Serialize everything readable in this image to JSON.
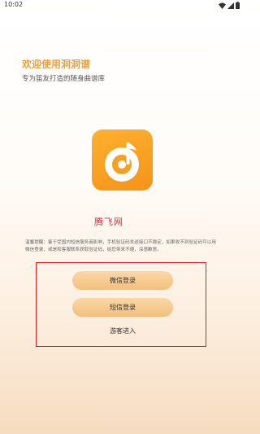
{
  "status_bar": {
    "time": "10:02",
    "icons": [
      "wifi-icon",
      "signal-icon",
      "battery-icon"
    ]
  },
  "welcome": {
    "title": "欢迎使用洞洞谱",
    "subtitle": "专为笛友打造的随身曲谱库"
  },
  "logo": {
    "icon": "music-note-logo-icon",
    "colors": {
      "primary": "#f5a623",
      "foreground": "#ffffff"
    }
  },
  "brand": {
    "name": "腾飞网"
  },
  "notice": {
    "text": "温馨提醒：鉴于受国内短信服务商影响，手机验证码发送接口不稳定，如果收不到验证码可以用微信登录，或是和客服联系获取验证码，给您带来不便，深感歉意。"
  },
  "actions": {
    "wechat_login": "微信登录",
    "sms_login": "短信登录",
    "guest_entry": "游客进入"
  },
  "colors": {
    "accent": "#f0a030",
    "button": "#f5c88a",
    "highlight_frame": "#e02020",
    "brand_text": "#e0283c"
  }
}
